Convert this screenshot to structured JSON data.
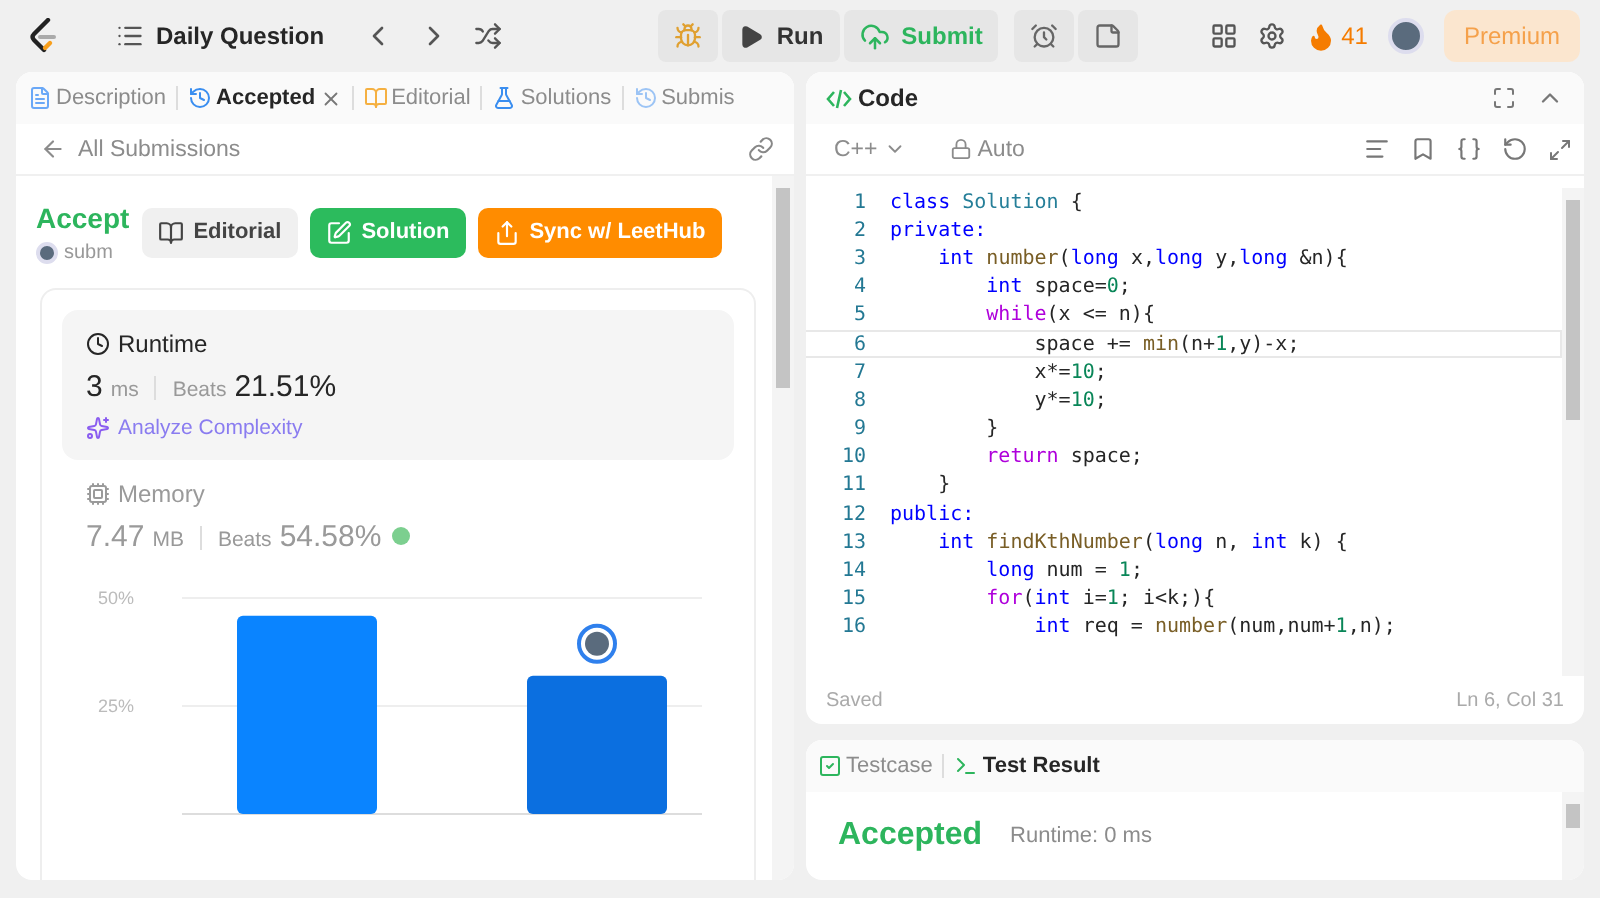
{
  "topbar": {
    "title": "Daily Question",
    "run": "Run",
    "submit": "Submit",
    "streak": "41",
    "premium": "Premium"
  },
  "left_tabs": [
    {
      "label": "Description",
      "kind": "description",
      "selected": false,
      "closable": false
    },
    {
      "label": "Accepted",
      "kind": "accepted",
      "selected": true,
      "closable": true
    },
    {
      "label": "Editorial",
      "kind": "editorial",
      "selected": false,
      "closable": false
    },
    {
      "label": "Solutions",
      "kind": "solutions",
      "selected": false,
      "closable": false
    },
    {
      "label": "Submis",
      "kind": "submissions",
      "selected": false,
      "closable": false
    }
  ],
  "back_link": "All Submissions",
  "submission": {
    "status": "Accept",
    "author": "subm"
  },
  "actions": [
    {
      "label": "Editorial",
      "kind": "neutral"
    },
    {
      "label": "Solution",
      "kind": "green"
    },
    {
      "label": "Sync w/ LeetHub",
      "kind": "orange"
    }
  ],
  "runtime": {
    "title": "Runtime",
    "value": "3",
    "unit": "ms",
    "beats_label": "Beats",
    "beats": "21.51%",
    "analyze": "Analyze Complexity",
    "selected": true
  },
  "memory": {
    "title": "Memory",
    "value": "7.47",
    "unit": "MB",
    "beats_label": "Beats",
    "beats": "54.58%",
    "selected": false
  },
  "chart_data": {
    "type": "bar",
    "values": [
      45.9,
      32
    ],
    "ylim": [
      0,
      50
    ],
    "yticks": [
      {
        "value": 50,
        "label": "50%"
      },
      {
        "value": 25,
        "label": "25%"
      }
    ]
  },
  "code_panel": {
    "title": "Code",
    "language": "C++",
    "mode": "Auto",
    "status": "Saved",
    "cursor": "Ln 6, Col 31",
    "lines": [
      {
        "n": "1",
        "current": false,
        "tokens": [
          {
            "kind": "kw",
            "text": "class "
          },
          {
            "kind": "type",
            "text": "Solution"
          },
          {
            "kind": "p",
            "text": " {"
          }
        ]
      },
      {
        "n": "2",
        "current": false,
        "tokens": [
          {
            "kind": "kw",
            "text": "private:"
          }
        ]
      },
      {
        "n": "3",
        "current": false,
        "tokens": [
          {
            "kind": "kw",
            "text": "    int "
          },
          {
            "kind": "fn",
            "text": "number"
          },
          {
            "kind": "p",
            "text": "("
          },
          {
            "kind": "kw",
            "text": "long"
          },
          {
            "kind": "p",
            "text": " x,"
          },
          {
            "kind": "kw",
            "text": "long"
          },
          {
            "kind": "p",
            "text": " y,"
          },
          {
            "kind": "kw",
            "text": "long"
          },
          {
            "kind": "p",
            "text": " &n){"
          }
        ]
      },
      {
        "n": "4",
        "current": false,
        "tokens": [
          {
            "kind": "kw",
            "text": "        int"
          },
          {
            "kind": "p",
            "text": " space="
          },
          {
            "kind": "num",
            "text": "0"
          },
          {
            "kind": "p",
            "text": ";"
          }
        ]
      },
      {
        "n": "5",
        "current": false,
        "tokens": [
          {
            "kind": "ctrl",
            "text": "        while"
          },
          {
            "kind": "p",
            "text": "(x <= n){"
          }
        ]
      },
      {
        "n": "6",
        "current": true,
        "tokens": [
          {
            "kind": "p",
            "text": "            space += "
          },
          {
            "kind": "fn",
            "text": "min"
          },
          {
            "kind": "p",
            "text": "(n+"
          },
          {
            "kind": "num",
            "text": "1"
          },
          {
            "kind": "p",
            "text": ",y)-x;"
          }
        ]
      },
      {
        "n": "7",
        "current": false,
        "tokens": [
          {
            "kind": "p",
            "text": "            x*="
          },
          {
            "kind": "num",
            "text": "10"
          },
          {
            "kind": "p",
            "text": ";"
          }
        ]
      },
      {
        "n": "8",
        "current": false,
        "tokens": [
          {
            "kind": "p",
            "text": "            y*="
          },
          {
            "kind": "num",
            "text": "10"
          },
          {
            "kind": "p",
            "text": ";"
          }
        ]
      },
      {
        "n": "9",
        "current": false,
        "tokens": [
          {
            "kind": "p",
            "text": "        }"
          }
        ]
      },
      {
        "n": "10",
        "current": false,
        "tokens": [
          {
            "kind": "ctrl",
            "text": "        return"
          },
          {
            "kind": "p",
            "text": " space;"
          }
        ]
      },
      {
        "n": "11",
        "current": false,
        "tokens": [
          {
            "kind": "p",
            "text": "    }"
          }
        ]
      },
      {
        "n": "12",
        "current": false,
        "tokens": [
          {
            "kind": "kw",
            "text": "public:"
          }
        ]
      },
      {
        "n": "13",
        "current": false,
        "tokens": [
          {
            "kind": "kw",
            "text": "    int "
          },
          {
            "kind": "fn",
            "text": "findKthNumber"
          },
          {
            "kind": "p",
            "text": "("
          },
          {
            "kind": "kw",
            "text": "long"
          },
          {
            "kind": "p",
            "text": " n, "
          },
          {
            "kind": "kw",
            "text": "int"
          },
          {
            "kind": "p",
            "text": " k) {"
          }
        ]
      },
      {
        "n": "14",
        "current": false,
        "tokens": [
          {
            "kind": "kw",
            "text": "        long"
          },
          {
            "kind": "p",
            "text": " num = "
          },
          {
            "kind": "num",
            "text": "1"
          },
          {
            "kind": "p",
            "text": ";"
          }
        ]
      },
      {
        "n": "15",
        "current": false,
        "tokens": [
          {
            "kind": "ctrl",
            "text": "        for"
          },
          {
            "kind": "p",
            "text": "("
          },
          {
            "kind": "kw",
            "text": "int"
          },
          {
            "kind": "p",
            "text": " i="
          },
          {
            "kind": "num",
            "text": "1"
          },
          {
            "kind": "p",
            "text": "; i<k;){"
          }
        ]
      },
      {
        "n": "16",
        "current": false,
        "tokens": [
          {
            "kind": "kw",
            "text": "            int"
          },
          {
            "kind": "p",
            "text": " req = "
          },
          {
            "kind": "fn",
            "text": "number"
          },
          {
            "kind": "p",
            "text": "(num,num+"
          },
          {
            "kind": "num",
            "text": "1"
          },
          {
            "kind": "p",
            "text": ",n);"
          }
        ]
      }
    ]
  },
  "result_tabs": [
    {
      "label": "Testcase",
      "kind": "testcase",
      "selected": false
    },
    {
      "label": "Test Result",
      "kind": "result",
      "selected": true
    }
  ],
  "result": {
    "verdict": "Accepted",
    "runtime": "Runtime: 0 ms"
  }
}
